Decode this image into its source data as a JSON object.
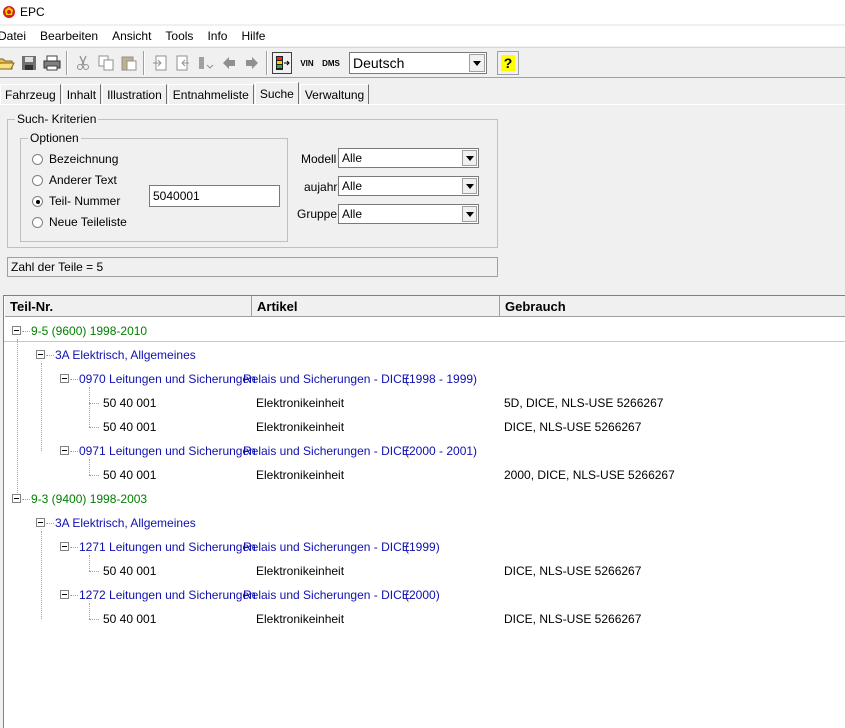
{
  "window": {
    "title": "EPC"
  },
  "menu": [
    "Datei",
    "Bearbeiten",
    "Ansicht",
    "Tools",
    "Info",
    "Hilfe"
  ],
  "toolbar": {
    "language": "Deutsch",
    "vin_label": "VIN",
    "dms_label": "DMS",
    "help_label": "?"
  },
  "tabs": [
    "Fahrzeug",
    "Inhalt",
    "Illustration",
    "Entnahmeliste",
    "Suche",
    "Verwaltung"
  ],
  "active_tab": "Suche",
  "search": {
    "criteria_title": "Such- Kriterien",
    "options_title": "Optionen",
    "options": [
      "Bezeichnung",
      "Anderer Text",
      "Teil- Nummer",
      "Neue Teileliste"
    ],
    "selected_option": "Teil- Nummer",
    "input_value": "5040001",
    "modell_label": "Modell",
    "modell_value": "Alle",
    "baujahr_label": "aujahr",
    "baujahr_value": "Alle",
    "gruppe_label": "Gruppe",
    "gruppe_value": "Alle"
  },
  "status": "Zahl der Teile = 5",
  "columns": [
    "Teil-Nr.",
    "Artikel",
    "Gebrauch"
  ],
  "tree": [
    {
      "model": "9-5 (9600) 1998-2010",
      "group": "3A Elektrisch, Allgemeines",
      "sections": [
        {
          "code": "0970 Leitungen und Sicherungen",
          "sub": "Relais und Sicherungen - DICE",
          "years": "(1998 - 1999)",
          "parts": [
            {
              "nr": "50 40 001",
              "artikel": "Elektronikeinheit",
              "gebrauch": "5D, DICE, NLS-USE 5266267"
            },
            {
              "nr": "50 40 001",
              "artikel": "Elektronikeinheit",
              "gebrauch": "DICE, NLS-USE 5266267"
            }
          ]
        },
        {
          "code": "0971 Leitungen und Sicherungen",
          "sub": "Relais und Sicherungen - DICE",
          "years": "(2000 - 2001)",
          "parts": [
            {
              "nr": "50 40 001",
              "artikel": "Elektronikeinheit",
              "gebrauch": "2000, DICE, NLS-USE 5266267"
            }
          ]
        }
      ]
    },
    {
      "model": "9-3 (9400) 1998-2003",
      "group": "3A Elektrisch, Allgemeines",
      "sections": [
        {
          "code": "1271 Leitungen und Sicherungen",
          "sub": "Relais und Sicherungen - DICE",
          "years": "(1999)",
          "parts": [
            {
              "nr": "50 40 001",
              "artikel": "Elektronikeinheit",
              "gebrauch": "DICE, NLS-USE 5266267"
            }
          ]
        },
        {
          "code": "1272 Leitungen und Sicherungen",
          "sub": "Relais und Sicherungen - DICE",
          "years": "(2000)",
          "parts": [
            {
              "nr": "50 40 001",
              "artikel": "Elektronikeinheit",
              "gebrauch": "DICE, NLS-USE 5266267"
            }
          ]
        }
      ]
    }
  ]
}
